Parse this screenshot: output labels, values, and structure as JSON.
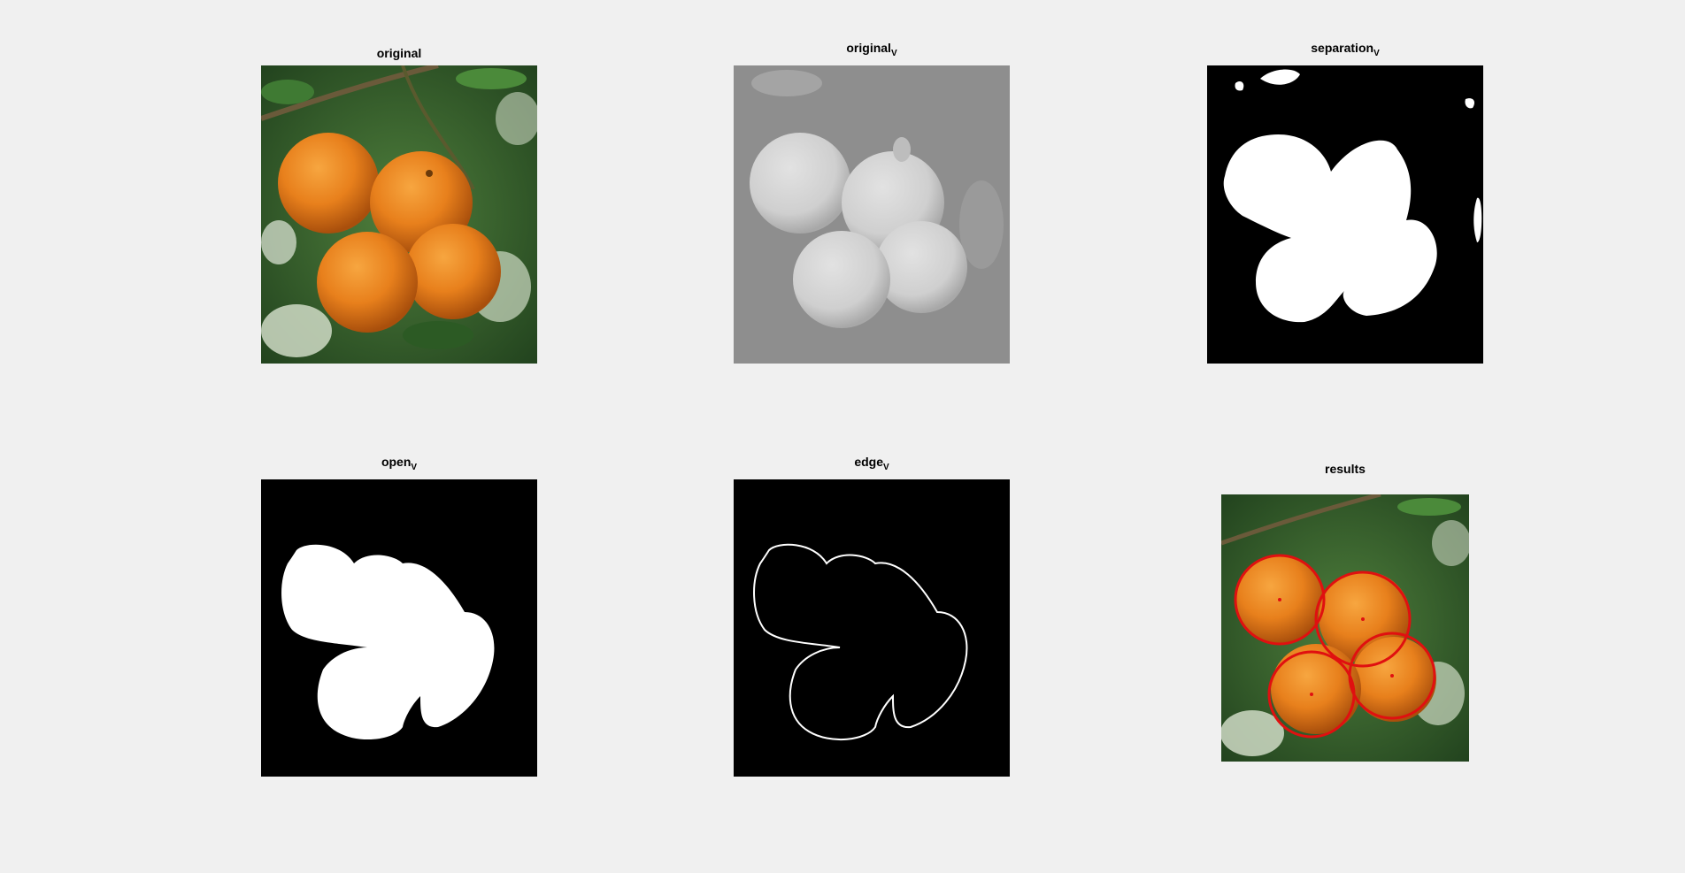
{
  "figure": {
    "background_color": "#f0f0f0",
    "panels": [
      {
        "id": "original",
        "title": "original",
        "subscript": "",
        "kind": "color-photo"
      },
      {
        "id": "original_v",
        "title": "original",
        "subscript": "V",
        "kind": "grayscale-photo"
      },
      {
        "id": "separation_v",
        "title": "separation",
        "subscript": "V",
        "kind": "binary-mask"
      },
      {
        "id": "open_v",
        "title": "open",
        "subscript": "V",
        "kind": "binary-mask"
      },
      {
        "id": "edge_v",
        "title": "edge",
        "subscript": "V",
        "kind": "edge-map"
      },
      {
        "id": "results",
        "title": "results",
        "subscript": "",
        "kind": "color-photo-with-circles"
      }
    ],
    "detection_circle_color": "#e01010",
    "fruit_color": "#e8801c",
    "foliage_color": "#2f6b2a"
  }
}
